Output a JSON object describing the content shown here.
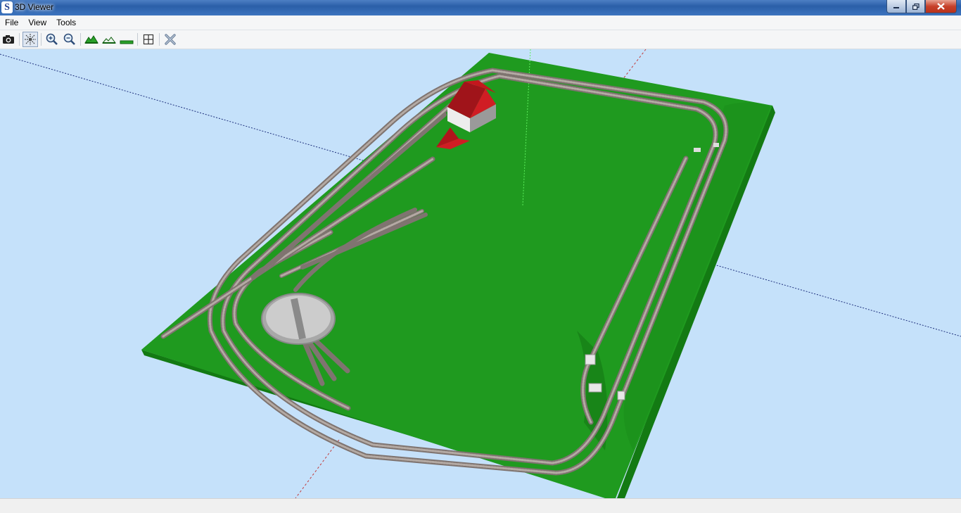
{
  "window": {
    "title": "3D Viewer",
    "app_icon_glyph": "S"
  },
  "menu": {
    "items": [
      "File",
      "View",
      "Tools"
    ]
  },
  "toolbar": {
    "tools": [
      {
        "name": "camera-icon",
        "tooltip": ""
      },
      {
        "name": "select-icon",
        "tooltip": ""
      },
      {
        "name": "zoom-in-icon",
        "tooltip": ""
      },
      {
        "name": "zoom-out-icon",
        "tooltip": ""
      },
      {
        "name": "terrain-high-icon",
        "tooltip": ""
      },
      {
        "name": "terrain-medium-icon",
        "tooltip": ""
      },
      {
        "name": "terrain-flat-icon",
        "tooltip": ""
      },
      {
        "name": "grid-icon",
        "tooltip": ""
      },
      {
        "name": "close-view-icon",
        "tooltip": ""
      }
    ]
  },
  "scene": {
    "background_color": "#c5e1fa",
    "board_color": "#1f9a1f",
    "board_side_color": "#137a13",
    "track_color": "#9a8d87",
    "building_roof_color": "#c4171d",
    "building_wall_color": "#e8e8e8",
    "turntable_color": "#c8c8c8"
  },
  "status": {
    "text": ""
  }
}
